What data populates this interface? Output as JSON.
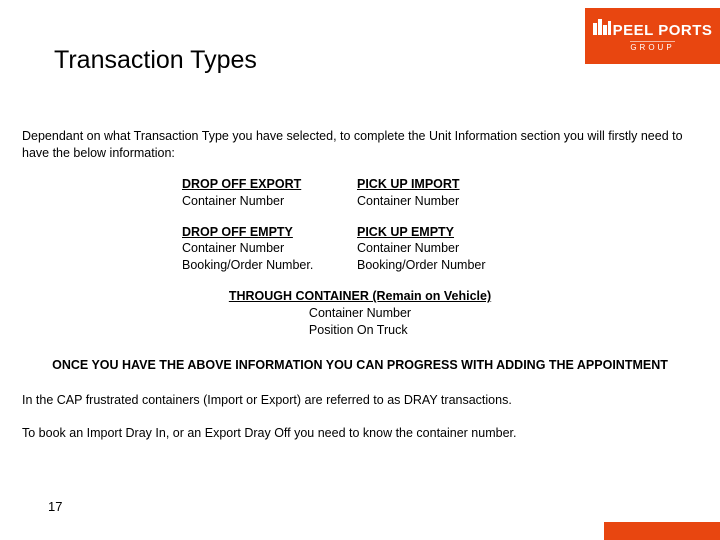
{
  "brand": {
    "name": "PEEL PORTS",
    "subtitle": "GROUP",
    "accent_color": "#e84610"
  },
  "title": "Transaction Types",
  "intro": "Dependant on what Transaction Type you have selected, to complete the Unit Information section you will firstly need to have the below information:",
  "types": {
    "drop_off_export": {
      "heading": "DROP OFF EXPORT",
      "lines": [
        "Container Number"
      ]
    },
    "pick_up_import": {
      "heading": "PICK UP IMPORT",
      "lines": [
        "Container Number"
      ]
    },
    "drop_off_empty": {
      "heading": "DROP OFF EMPTY",
      "lines": [
        "Container Number",
        "Booking/Order Number."
      ]
    },
    "pick_up_empty": {
      "heading": "PICK UP EMPTY",
      "lines": [
        "Container Number",
        "Booking/Order Number"
      ]
    },
    "through": {
      "heading": "THROUGH CONTAINER (Remain on Vehicle)",
      "lines": [
        "Container Number",
        "Position On Truck"
      ]
    }
  },
  "confirm_line": "ONCE YOU HAVE THE ABOVE INFORMATION YOU CAN PROGRESS WITH ADDING THE APPOINTMENT",
  "para1": "In the CAP frustrated containers (Import or Export) are referred to as DRAY transactions.",
  "para2": "To book an Import Dray In, or an Export Dray Off you need to know the container number.",
  "page_number": "17"
}
